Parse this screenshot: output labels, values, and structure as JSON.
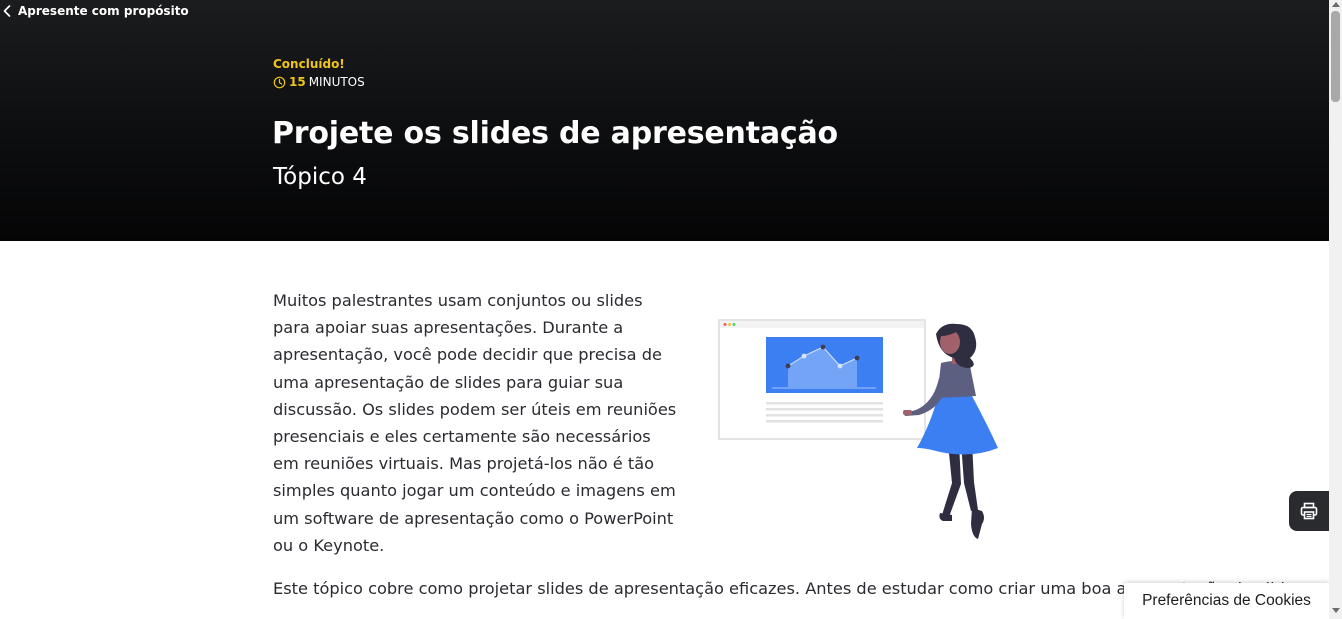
{
  "header": {
    "back_label": "Apresente com propósito",
    "status": "Concluído!",
    "duration_value": "15",
    "duration_unit": "MINUTOS",
    "title": "Projete os slides de apresentação",
    "subtitle": "Tópico 4"
  },
  "content": {
    "paragraph1": "Muitos palestrantes usam conjuntos ou slides para apoiar suas apresentações. Durante a apresentação, você pode decidir que precisa de uma apresentação de slides para guiar sua discussão. Os slides podem ser úteis em reuniões presenciais e eles certamente são necessários em reuniões virtuais. Mas projetá-los não é tão simples quanto jogar um conteúdo e imagens em um software de apresentação como o PowerPoint ou o Keynote.",
    "paragraph2": "Este tópico cobre como projetar slides de apresentação eficazes. Antes de estudar como criar uma boa apresentação de slides, você verá"
  },
  "widgets": {
    "print_icon": "printer-icon",
    "cookie_label": "Preferências de Cookies"
  },
  "colors": {
    "accent": "#f0c419",
    "hero_bg": "#0d0e10",
    "illustration_blue": "#3b7ff2"
  }
}
